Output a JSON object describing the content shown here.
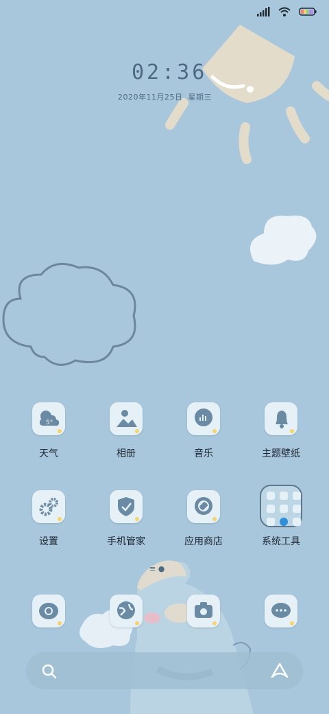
{
  "status_bar": {
    "battery_icon": "battery-icon",
    "wifi_icon": "wifi-icon",
    "signal_icon": "signal-icon"
  },
  "clock": {
    "time": "02:36",
    "date": "2020年11月25日",
    "weekday": "星期三"
  },
  "apps_row1": [
    {
      "label": "天气",
      "icon": "weather-icon",
      "badge": "5°"
    },
    {
      "label": "相册",
      "icon": "gallery-icon"
    },
    {
      "label": "音乐",
      "icon": "music-icon"
    },
    {
      "label": "主题壁纸",
      "icon": "theme-icon"
    }
  ],
  "apps_row2": [
    {
      "label": "设置",
      "icon": "settings-icon"
    },
    {
      "label": "手机管家",
      "icon": "security-icon"
    },
    {
      "label": "应用商店",
      "icon": "app-store-icon"
    },
    {
      "label": "系统工具",
      "icon": "folder-icon"
    }
  ],
  "dock": [
    {
      "icon": "phone-icon"
    },
    {
      "icon": "browser-icon"
    },
    {
      "icon": "camera-icon"
    },
    {
      "icon": "messages-icon"
    }
  ],
  "search": {
    "search_icon": "search-icon",
    "assistant_icon": "assistant-icon"
  },
  "colors": {
    "background": "#a9c7dc",
    "icon_bg": "#e6f1f7",
    "accent": "#6b8aa3",
    "sun": "#e4dccb"
  }
}
